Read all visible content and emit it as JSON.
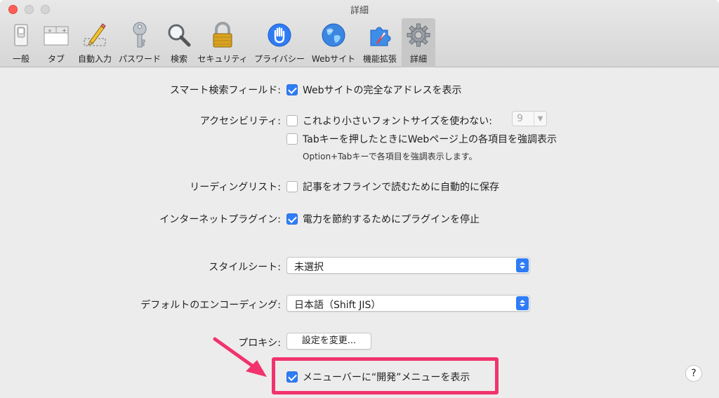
{
  "window": {
    "title": "詳細"
  },
  "tabs": [
    {
      "label": "一般",
      "icon": "switch-icon"
    },
    {
      "label": "タブ",
      "icon": "tabs-icon"
    },
    {
      "label": "自動入力",
      "icon": "pencil-icon"
    },
    {
      "label": "パスワード",
      "icon": "key-icon"
    },
    {
      "label": "検索",
      "icon": "magnifier-icon"
    },
    {
      "label": "セキュリティ",
      "icon": "lock-icon"
    },
    {
      "label": "プライバシー",
      "icon": "hand-icon"
    },
    {
      "label": "Webサイト",
      "icon": "globe-icon"
    },
    {
      "label": "機能拡張",
      "icon": "puzzle-icon"
    },
    {
      "label": "詳細",
      "icon": "gear-icon"
    }
  ],
  "active_tab": "詳細",
  "settings": {
    "smart_search": {
      "label": "スマート検索フィールド:",
      "option": "Webサイトの完全なアドレスを表示",
      "checked": true
    },
    "accessibility": {
      "label": "アクセシビリティ:",
      "option_font": "これより小さいフォントサイズを使わない:",
      "font_size_value": "9",
      "font_checked": false,
      "option_tab": "Tabキーを押したときにWebページ上の各項目を強調表示",
      "tab_checked": false,
      "note": "Option+Tabキーで各項目を強調表示します。"
    },
    "reading_list": {
      "label": "リーディングリスト:",
      "option": "記事をオフラインで読むために自動的に保存",
      "checked": false
    },
    "plugins": {
      "label": "インターネットプラグイン:",
      "option": "電力を節約するためにプラグインを停止",
      "checked": true
    },
    "stylesheet": {
      "label": "スタイルシート:",
      "value": "未選択"
    },
    "encoding": {
      "label": "デフォルトのエンコーディング:",
      "value": "日本語（Shift JIS）"
    },
    "proxy": {
      "label": "プロキシ:",
      "button": "設定を変更..."
    },
    "develop_menu": {
      "option": "メニューバーに“開発”メニューを表示",
      "checked": true
    }
  },
  "help": {
    "label": "?"
  },
  "colors": {
    "accent": "#2f7cf6",
    "highlight": "#f2336d"
  }
}
